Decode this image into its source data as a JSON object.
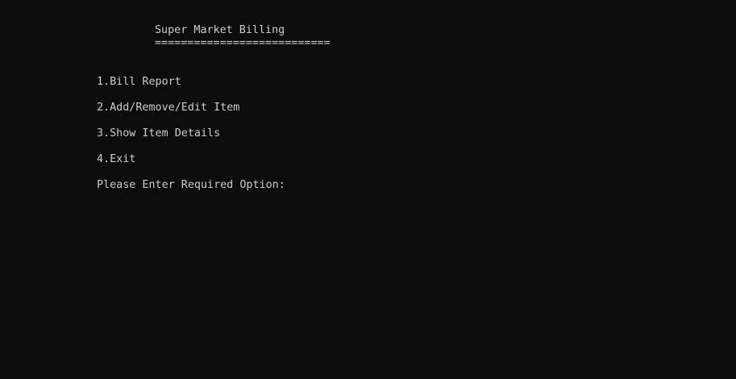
{
  "console": {
    "title": "Super Market Billing",
    "title_underline": "==========================="
  },
  "menu": {
    "items": [
      {
        "label": "1.Bill Report"
      },
      {
        "label": "2.Add/Remove/Edit Item"
      },
      {
        "label": "3.Show Item Details"
      },
      {
        "label": "4.Exit"
      }
    ]
  },
  "prompt": {
    "text": "Please Enter Required Option:",
    "value": ""
  },
  "colors": {
    "background": "#0c0c0c",
    "foreground": "#cccccc"
  }
}
